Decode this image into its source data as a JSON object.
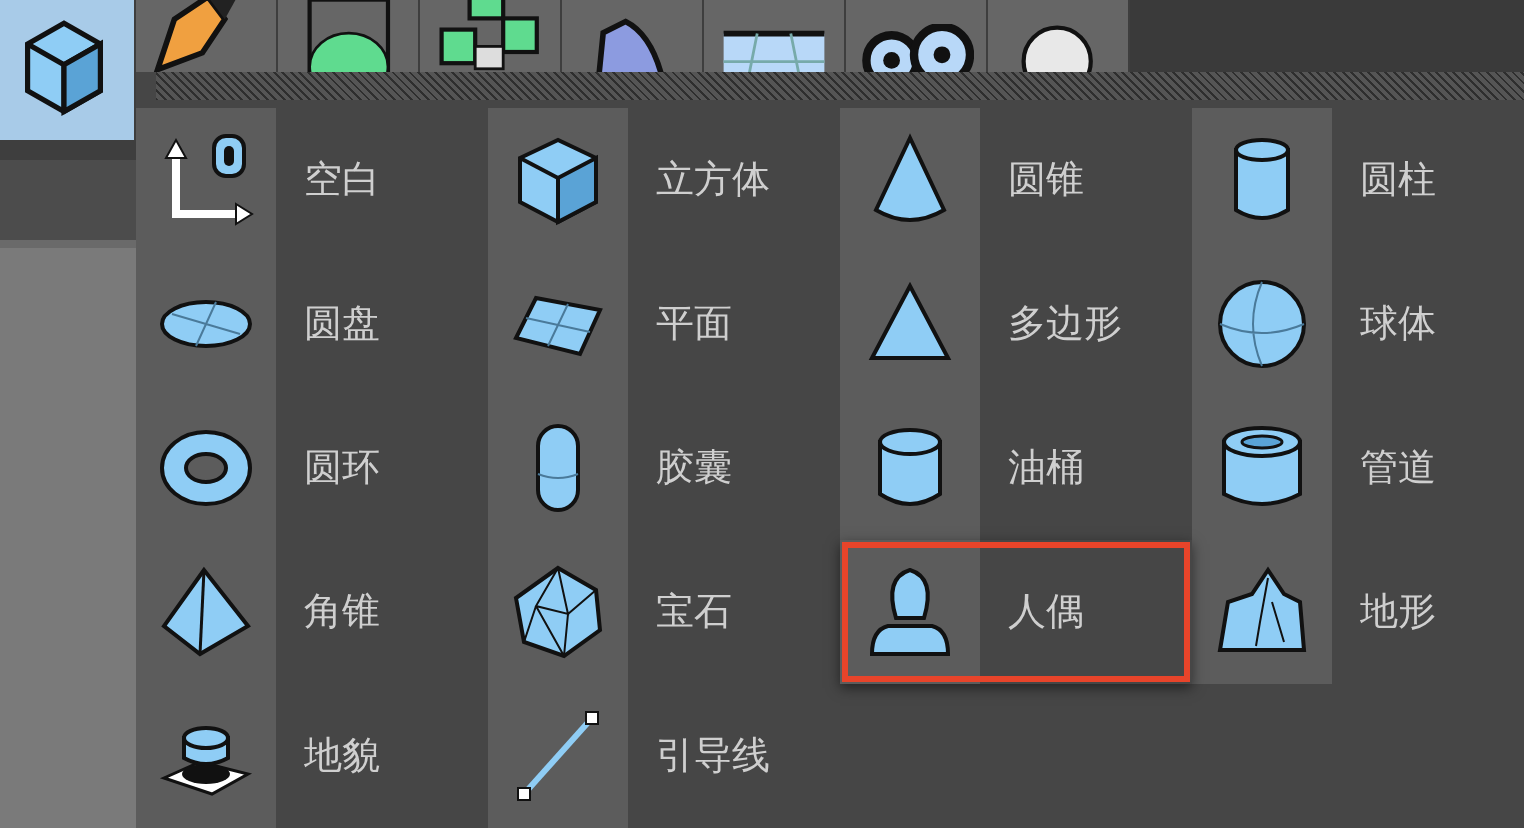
{
  "toolbar": {
    "tools": [
      {
        "selected": true
      },
      {
        "selected": false
      },
      {
        "selected": false
      },
      {
        "selected": false
      },
      {
        "selected": false
      },
      {
        "selected": false
      },
      {
        "selected": false
      },
      {
        "selected": false
      }
    ]
  },
  "menu": {
    "items": [
      {
        "label": "空白",
        "highlighted": false
      },
      {
        "label": "立方体",
        "highlighted": false
      },
      {
        "label": "圆锥",
        "highlighted": false
      },
      {
        "label": "圆柱",
        "highlighted": false
      },
      {
        "label": "圆盘",
        "highlighted": false
      },
      {
        "label": "平面",
        "highlighted": false
      },
      {
        "label": "多边形",
        "highlighted": false
      },
      {
        "label": "球体",
        "highlighted": false
      },
      {
        "label": "圆环",
        "highlighted": false
      },
      {
        "label": "胶囊",
        "highlighted": false
      },
      {
        "label": "油桶",
        "highlighted": false
      },
      {
        "label": "管道",
        "highlighted": false
      },
      {
        "label": "角锥",
        "highlighted": false
      },
      {
        "label": "宝石",
        "highlighted": false
      },
      {
        "label": "人偶",
        "highlighted": true
      },
      {
        "label": "地形",
        "highlighted": false
      },
      {
        "label": "地貌",
        "highlighted": false
      },
      {
        "label": "引导线",
        "highlighted": false
      }
    ]
  }
}
